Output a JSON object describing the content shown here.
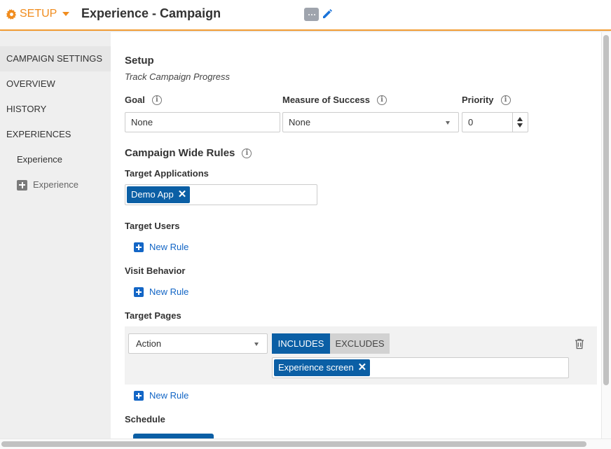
{
  "header": {
    "setup_label": "SETUP",
    "title": "Experience - Campaign",
    "more_icon": "more-dots-icon",
    "edit_icon": "pencil-icon",
    "accent": "#f39c34"
  },
  "sidebar": {
    "items": [
      {
        "label": "CAMPAIGN SETTINGS"
      },
      {
        "label": "OVERVIEW"
      },
      {
        "label": "HISTORY"
      },
      {
        "label": "EXPERIENCES"
      },
      {
        "label": "Experience"
      },
      {
        "label": "Experience"
      }
    ]
  },
  "setup": {
    "heading": "Setup",
    "subtitle": "Track Campaign Progress",
    "goal_label": "Goal",
    "goal_value": "None",
    "measure_label": "Measure of Success",
    "measure_value": "None",
    "priority_label": "Priority",
    "priority_value": "0"
  },
  "rules": {
    "heading": "Campaign Wide Rules",
    "target_apps_label": "Target Applications",
    "target_apps_tag": "Demo App",
    "target_users_label": "Target Users",
    "visit_behavior_label": "Visit Behavior",
    "target_pages_label": "Target Pages",
    "new_rule_label": "New Rule",
    "page_rule": {
      "type_value": "Action",
      "includes_label": "INCLUDES",
      "excludes_label": "EXCLUDES",
      "tag": "Experience screen"
    },
    "schedule_label": "Schedule",
    "tag_color": "#0b5fa5",
    "link_color": "#1366c6"
  }
}
